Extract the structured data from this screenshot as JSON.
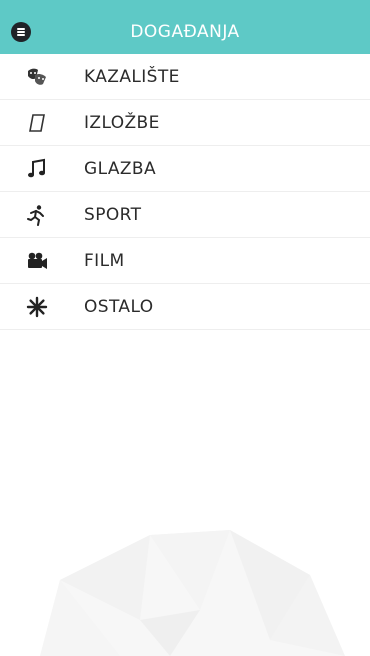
{
  "header": {
    "title": "DOGAĐANJA",
    "menu_icon": "hamburger-circle-icon",
    "background_color": "#5ec9c6",
    "title_color": "#ffffff"
  },
  "menu": {
    "items": [
      {
        "label": "KAZALIŠTE",
        "icon": "theater-masks-icon"
      },
      {
        "label": "IZLOŽBE",
        "icon": "frame-icon"
      },
      {
        "label": "GLAZBA",
        "icon": "music-note-icon"
      },
      {
        "label": "SPORT",
        "icon": "running-person-icon"
      },
      {
        "label": "FILM",
        "icon": "film-camera-icon"
      },
      {
        "label": "OSTALO",
        "icon": "asterisk-icon"
      }
    ]
  },
  "colors": {
    "text": "#2b2b2b",
    "divider": "#eeeeee",
    "background": "#ffffff"
  }
}
